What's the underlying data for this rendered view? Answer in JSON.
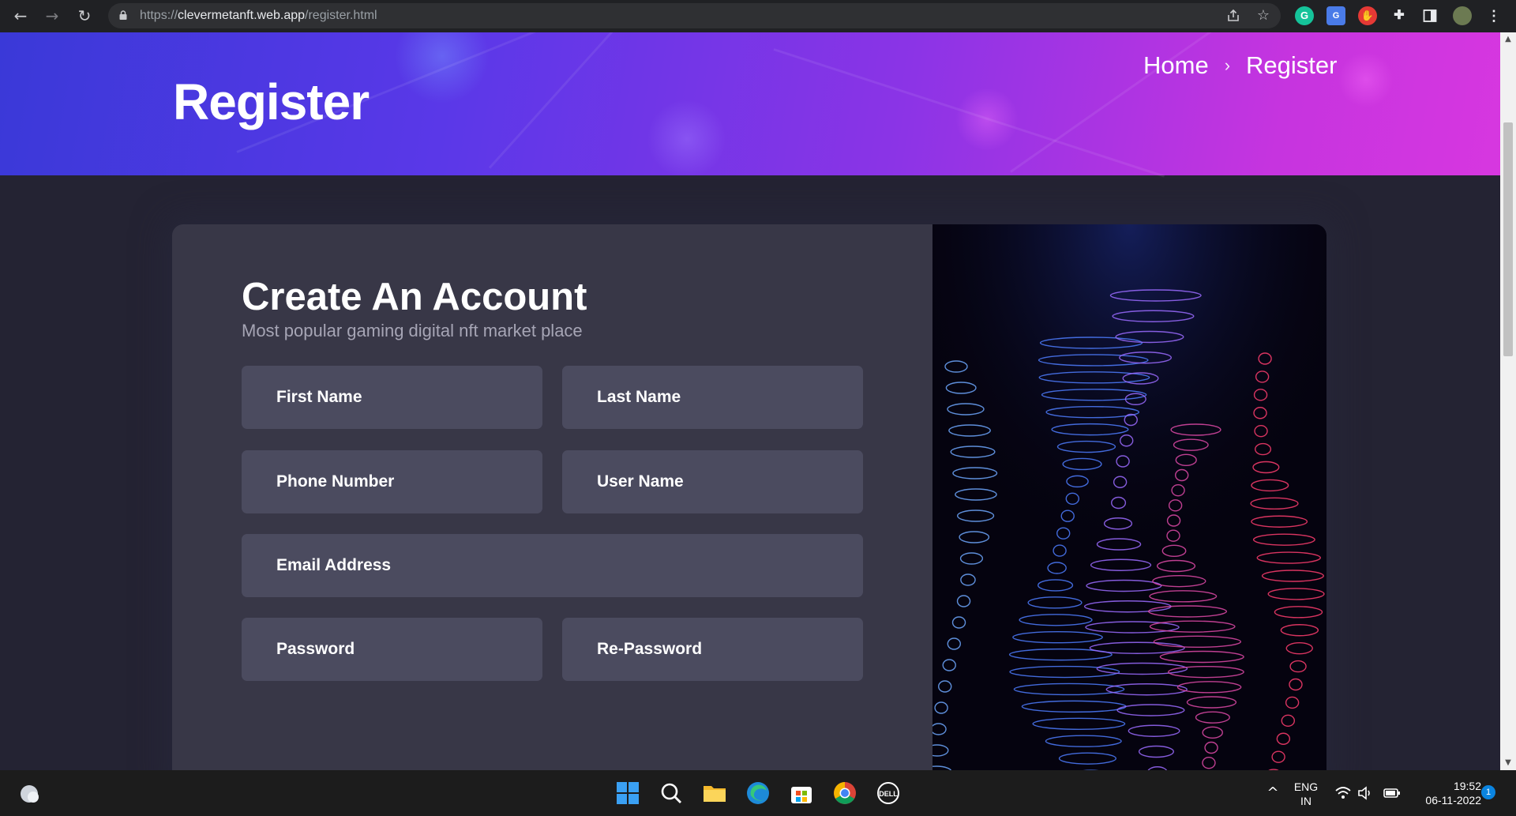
{
  "browser": {
    "url_scheme": "https://",
    "url_host": "clevermetanft.web.app",
    "url_path": "/register.html",
    "colors": {
      "chrome_bg": "#202124",
      "omnibox_bg": "#2f3033"
    }
  },
  "hero": {
    "title": "Register",
    "breadcrumb": {
      "home": "Home",
      "separator": "›",
      "current": "Register"
    }
  },
  "form": {
    "title": "Create An Account",
    "subtitle": "Most popular gaming digital nft market place",
    "fields": {
      "first_name": "First Name",
      "last_name": "Last Name",
      "phone_number": "Phone Number",
      "user_name": "User Name",
      "email": "Email Address",
      "password": "Password",
      "re_password": "Re-Password"
    }
  },
  "taskbar": {
    "lang_line1": "ENG",
    "lang_line2": "IN",
    "time": "19:52",
    "date": "06-11-2022",
    "notification_count": "1"
  },
  "colors": {
    "page_bg": "#242333",
    "card_bg": "#383747",
    "field_bg": "#4b4b5f",
    "hero_start": "#3a39d8",
    "hero_end": "#d737e0"
  }
}
